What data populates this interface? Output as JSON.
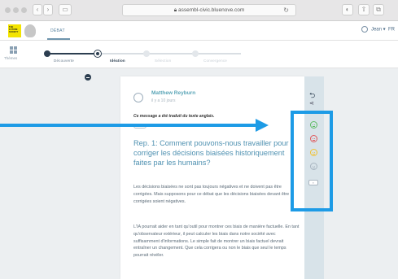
{
  "browser": {
    "url": "assembl-civic.bluenove.com",
    "lock_icon": "lock-icon"
  },
  "header": {
    "logo_text": "THE FUTURE SOCIETY",
    "nav_item": "DÉBAT",
    "user_name": "Jean",
    "language": "FR",
    "accent_color": "#6e94ad"
  },
  "phases": {
    "themes_label": "Thèmes",
    "items": [
      {
        "label": "Découverte",
        "state": "done"
      },
      {
        "label": "Idéation",
        "state": "current"
      },
      {
        "label": "Sélection",
        "state": "upcoming"
      },
      {
        "label": "Convergence",
        "state": "upcoming"
      }
    ]
  },
  "post": {
    "author": "Matthew Reyburn",
    "time": "il y a 10 jours",
    "translated_notice": "Ce message a été traduit du texte anglais.",
    "title": "Rep. 1: Comment pouvons-nous travailler pour corriger les décisions biaisées historiquement faites par les humains?",
    "paragraph_1": "Les décisions biaisées ne sont pas toujours négatives et ne doivent pas être corrigées. Mais supposons pour ce débat que les décisions biaisées devant être corrigées soient négatives.",
    "paragraph_2": "L'IA pourrait aider en tant qu'outil pour montrer ces biais de manière factuelle. En tant qu'observateur extérieur, il peut calculer les biais dans notre société avec suffisamment d'informations. Le simple fait de montrer un biais factuel devrait entraîner un changement. Que cela corrigera ou non le biais que seul le temps pourrait révéler."
  },
  "side_actions": {
    "reply_icon": "reply-icon",
    "share_icon": "share-icon",
    "sentiments": [
      {
        "name": "like-sentiment-icon",
        "color": "#5dbb63"
      },
      {
        "name": "disagree-sentiment-icon",
        "color": "#e0585b"
      },
      {
        "name": "dont-understand-sentiment-icon",
        "color": "#f1c232"
      },
      {
        "name": "more-info-sentiment-icon",
        "color": "#a8b5c0"
      }
    ],
    "count_icon": "sentiment-count-icon"
  },
  "annotation": {
    "color": "#1d9be6"
  }
}
